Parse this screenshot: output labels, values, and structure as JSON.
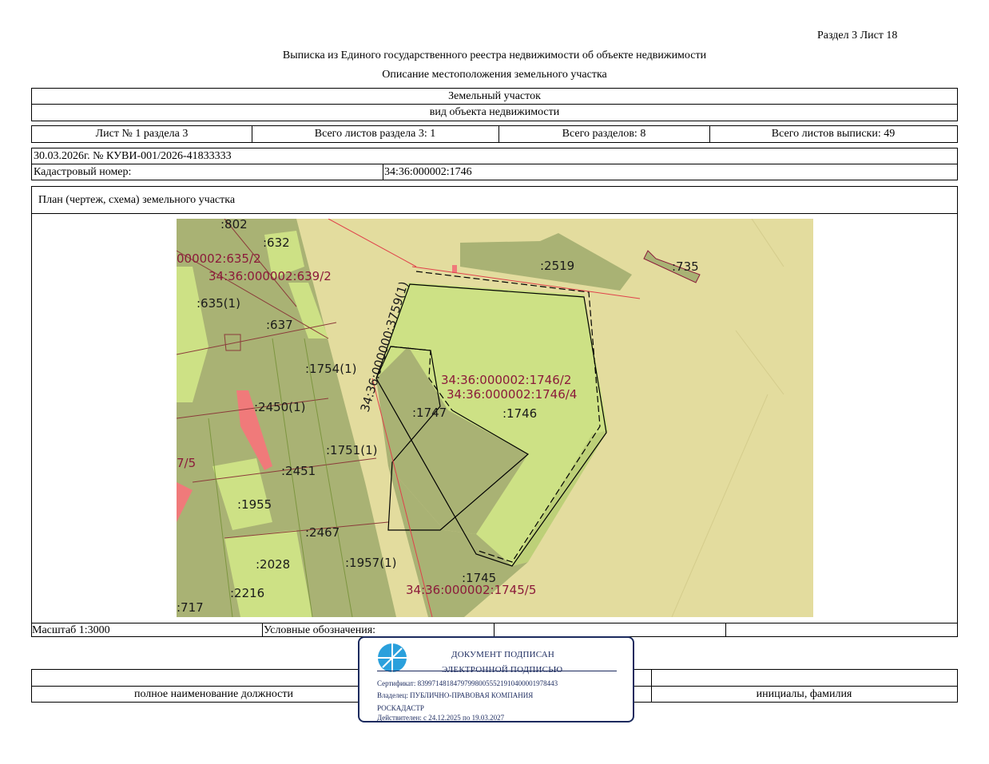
{
  "header": {
    "section_sheet": "Раздел 3    Лист 18",
    "title": "Выписка из Единого государственного реестра недвижимости об объекте недвижимости",
    "subtitle": "Описание местоположения земельного участка"
  },
  "object": {
    "name": "Земельный участок",
    "kind_caption": "вид объекта недвижимости"
  },
  "sheets": {
    "sheet_num": "Лист № 1 раздела 3",
    "total_section_sheets": "Всего листов раздела 3: 1",
    "total_sections": "Всего разделов: 8",
    "total_extract_sheets": "Всего листов выписки: 49"
  },
  "doc": {
    "date_number": "30.03.2026г. № КУВИ-001/2026-41833333",
    "cadastral_label": "Кадастровый номер:",
    "cadastral_value": "34:36:000002:1746"
  },
  "plan": {
    "title": "План (чертеж, схема) земельного участка",
    "labels_dark": [
      ":802",
      ":632",
      ":635(1)",
      ":637",
      ":1754(1)",
      ":2450(1)",
      ":1751(1)",
      ":2451",
      ":1955",
      ":2467",
      ":2028",
      ":1957(1)",
      ":2216",
      ":717",
      ":1747",
      ":1746",
      ":1745",
      ":2519",
      ":735"
    ],
    "labels_red": [
      "000002:635/2",
      "34:36:000002:639/2",
      "34:36:000002:1746/2",
      "34:36:000002:1746/4",
      "34:36:000002:1745/5",
      "7/5"
    ],
    "rotated_label": "34:36:000000:3759(1)",
    "colors": {
      "background": "#e3dc9e",
      "parcel_dark": "#a9b274",
      "parcel_light": "#cde185",
      "building": "#f07a7a",
      "red_line": "#e0404a"
    }
  },
  "legend": {
    "scale": "Масштаб 1:3000",
    "legend_label": "Условные обозначения:"
  },
  "signature": {
    "position_caption": "полное наименование должности",
    "name_caption": "инициалы, фамилия"
  },
  "stamp": {
    "line1": "ДОКУМЕНТ ПОДПИСАН",
    "line2": "ЭЛЕКТРОННОЙ ПОДПИСЬЮ",
    "certificate": "Сертификат: 839971481847979980055521910400001978443",
    "owner": "Владелец: ПУБЛИЧНО-ПРАВОВАЯ КОМПАНИЯ",
    "owner2": "РОСКАДАСТР",
    "valid": "Действителен: с 24.12.2025 по 19.03.2027",
    "icon": "globe-logo-icon"
  }
}
